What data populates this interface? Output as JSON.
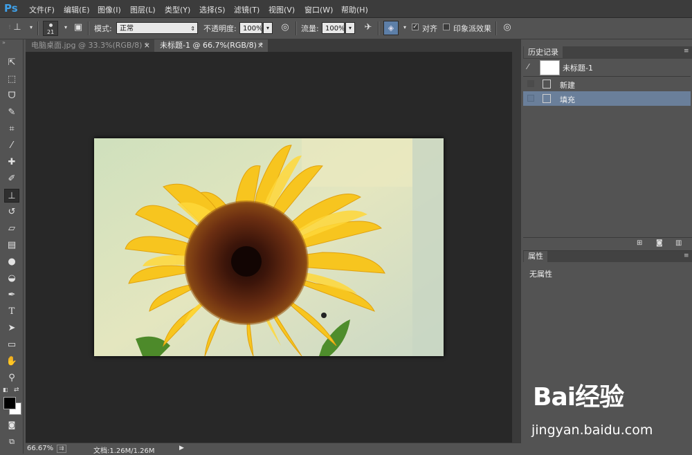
{
  "app": {
    "logo": "Ps"
  },
  "menu": [
    "文件(F)",
    "编辑(E)",
    "图像(I)",
    "图层(L)",
    "类型(Y)",
    "选择(S)",
    "滤镜(T)",
    "视图(V)",
    "窗口(W)",
    "帮助(H)"
  ],
  "options": {
    "brush_size": "21",
    "mode_label": "模式:",
    "mode_value": "正常",
    "opacity_label": "不透明度:",
    "opacity_value": "100%",
    "flow_label": "流量:",
    "flow_value": "100%",
    "align_label": "对齐",
    "align_checked": true,
    "impressionist_label": "印象派效果",
    "impressionist_checked": false
  },
  "tabs": [
    {
      "label": "电脑桌面.jpg @ 33.3%(RGB/8) *",
      "active": false,
      "close": "×"
    },
    {
      "label": "未标题-1 @ 66.7%(RGB/8) *",
      "active": true,
      "close": "×"
    }
  ],
  "status": {
    "zoom": "66.67%",
    "doc_size": "文档:1.26M/1.26M"
  },
  "history": {
    "tab_label": "历史记录",
    "snapshot_label": "未标题-1",
    "items": [
      {
        "label": "新建",
        "selected": false
      },
      {
        "label": "填充",
        "selected": true
      }
    ]
  },
  "properties": {
    "tab_label": "属性",
    "empty_text": "无属性"
  },
  "watermark": {
    "brand": "Bai经验",
    "url": "jingyan.baidu.com"
  },
  "colors": {
    "accent_selected": "#6a7f9a",
    "canvas_bg": "#282828",
    "panel_bg": "#535353",
    "logo": "#3fa0e8"
  }
}
